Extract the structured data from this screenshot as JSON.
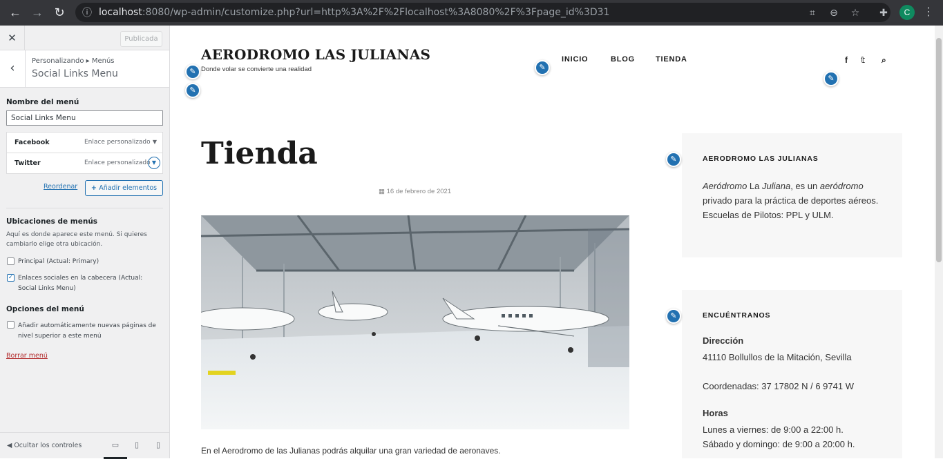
{
  "browser": {
    "url_host": "localhost",
    "url_rest": ":8080/wp-admin/customize.php?url=http%3A%2F%2Flocalhost%3A8080%2F%3Fpage_id%3D31",
    "avatar_letter": "C"
  },
  "customizer": {
    "close": "✕",
    "publish_label": "Publicada",
    "breadcrumb": "Personalizando ▸ Menús",
    "section_title": "Social Links Menu",
    "menu_name_label": "Nombre del menú",
    "menu_name_value": "Social Links Menu",
    "items": [
      {
        "title": "Facebook",
        "type": "Enlace personalizado"
      },
      {
        "title": "Twitter",
        "type": "Enlace personalizado"
      }
    ],
    "reorder_label": "Reordenar",
    "add_items_label": "Añadir elementos",
    "locations_title": "Ubicaciones de menús",
    "locations_desc": "Aquí es donde aparece este menú. Si quieres cambiarlo elige otra ubicación.",
    "locations": [
      {
        "label": "Principal (Actual: Primary)",
        "checked": false
      },
      {
        "label": "Enlaces sociales en la cabecera (Actual: Social Links Menu)",
        "checked": true
      }
    ],
    "options_title": "Opciones del menú",
    "options": [
      {
        "label": "Añadir automáticamente nuevas páginas de nivel superior a este menú",
        "checked": false
      }
    ],
    "delete_label": "Borrar menú",
    "hide_controls_label": "Ocultar los controles"
  },
  "site": {
    "title": "AERODROMO LAS JULIANAS",
    "tagline": "Donde volar se convierte una realidad",
    "nav": [
      "INICIO",
      "BLOG",
      "TIENDA"
    ],
    "page_title": "Tienda",
    "date": "16 de febrero de 2021",
    "excerpt": "En el Aerodromo de las Julianas podrás alquilar una gran variedad de aeronaves.",
    "widget1": {
      "title": "AERODROMO LAS JULIANAS",
      "text_em1": "Aeródromo",
      "text_1": " La ",
      "text_em2": "Juliana",
      "text_2": ", es un ",
      "text_em3": "aeródromo",
      "text_3": " privado para la práctica de deportes aéreos. Escuelas de Pilotos: PPL y ULM."
    },
    "widget2": {
      "title": "ENCUÉNTRANOS",
      "dir_heading": "Dirección",
      "address": "41110 Bollullos de la Mitación, Sevilla",
      "coords": "Coordenadas: 37 17802 N / 6 9741 W",
      "hours_heading": "Horas",
      "hours1": "Lunes a viernes: de 9:00 a 22:00 h.",
      "hours2": "Sábado y domingo: de 9:00 a 20:00 h."
    }
  }
}
